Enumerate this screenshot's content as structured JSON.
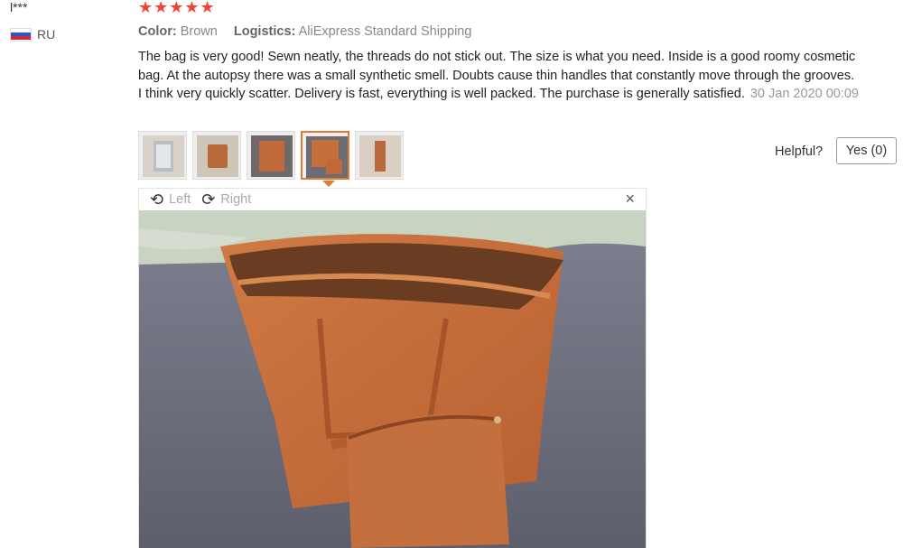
{
  "review": {
    "user": "l***",
    "country": "RU",
    "stars": "★★★★★",
    "color_label": "Color:",
    "color_value": "Brown",
    "logistics_label": "Logistics:",
    "logistics_value": "AliExpress Standard Shipping",
    "text": "The bag is very good! Sewn neatly, the threads do not stick out. The size is what you need. Inside is a good roomy cosmetic bag. At the autopsy there was a small synthetic smell. Doubts cause thin handles that constantly move through the grooves. I think very quickly scatter. Delivery is fast, everything is well packed. The purchase is generally satisfied.",
    "date": "30 Jan 2020 00:09"
  },
  "helpful": {
    "label": "Helpful?",
    "yes_button": "Yes (0)"
  },
  "viewer": {
    "rotate_left": "Left",
    "rotate_right": "Right",
    "close": "×"
  },
  "colors": {
    "star": "#f44336",
    "accent": "#e07a35"
  }
}
